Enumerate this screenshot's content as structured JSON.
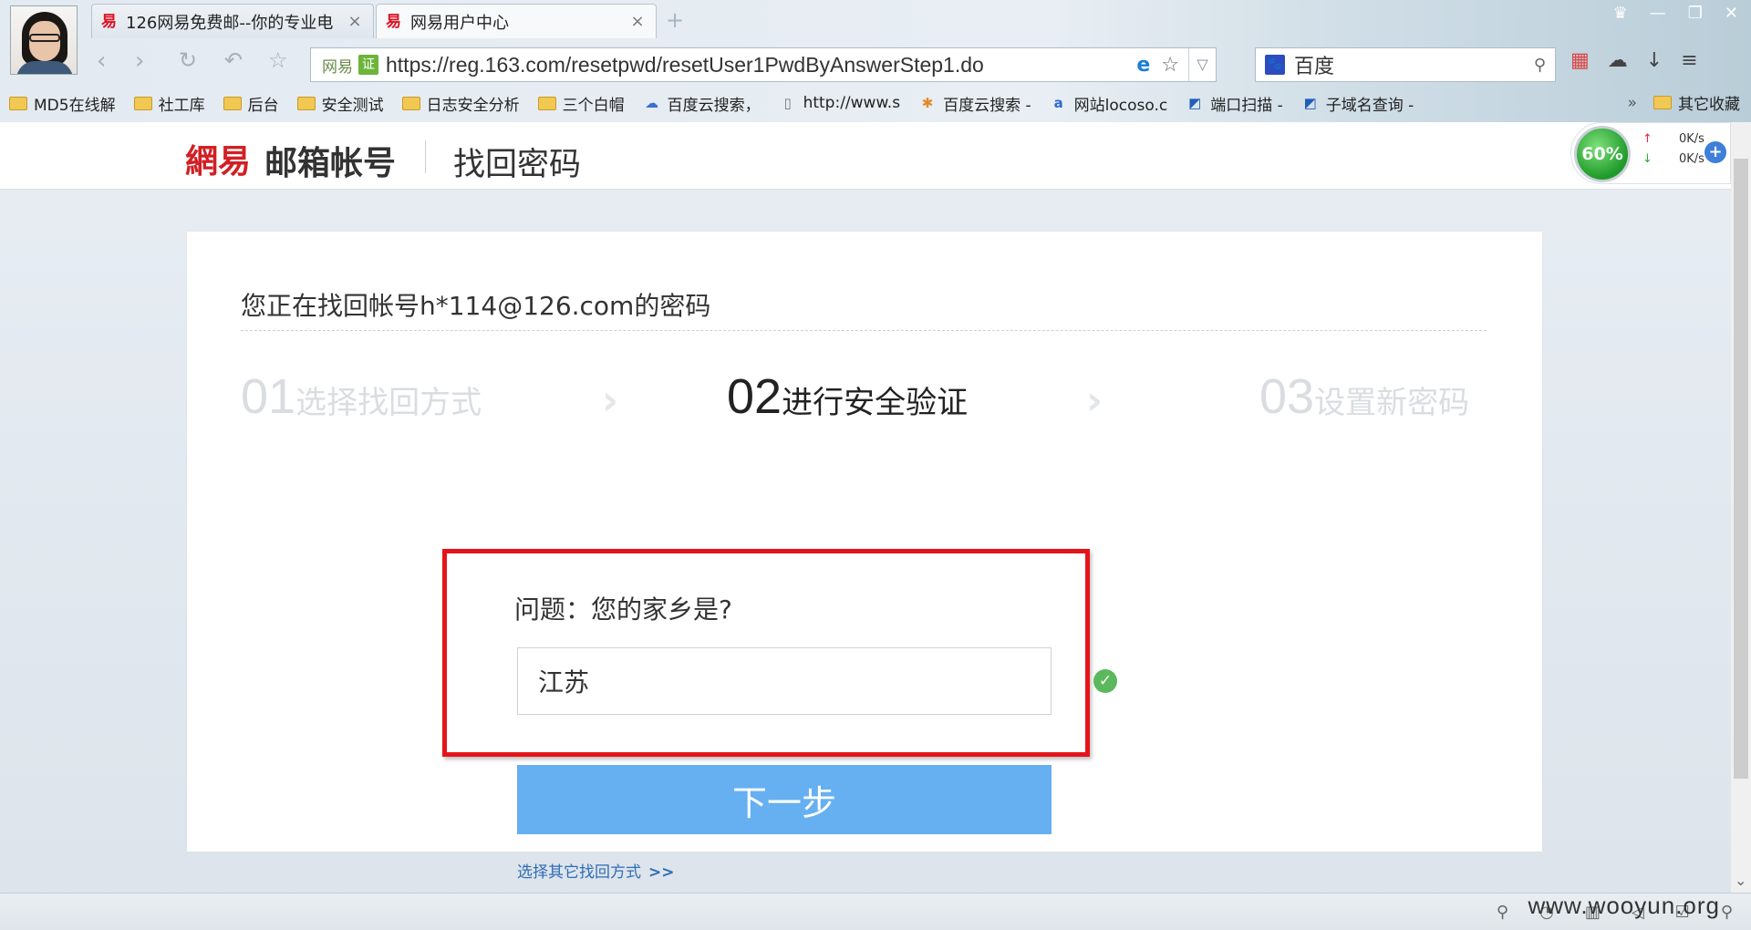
{
  "browser": {
    "tabs": [
      {
        "label": "126网易免费邮--你的专业电",
        "favicon": "易"
      },
      {
        "label": "网易用户中心",
        "favicon": "易"
      }
    ],
    "tab_close": "×",
    "new_tab": "+",
    "address": {
      "site_label": "网易",
      "cert_label": "证",
      "url": "https://reg.163.com/resetpwd/resetUser1PwdByAnswerStep1.do"
    },
    "search": {
      "engine": "百度"
    },
    "bookmarks": [
      {
        "label": "MD5在线解",
        "icon": "folder-icon"
      },
      {
        "label": "社工库",
        "icon": "folder-icon"
      },
      {
        "label": "后台",
        "icon": "folder-icon"
      },
      {
        "label": "安全测试",
        "icon": "folder-icon"
      },
      {
        "label": "日志安全分析",
        "icon": "folder-icon"
      },
      {
        "label": "三个白帽",
        "icon": "folder-icon"
      },
      {
        "label": "百度云搜索，",
        "icon": "cloud-icon"
      },
      {
        "label": "http://www.s",
        "icon": "page-icon"
      },
      {
        "label": "百度云搜索 -",
        "icon": "puzzle-icon"
      },
      {
        "label": "网站locoso.c",
        "icon": "a-icon"
      },
      {
        "label": "端口扫描 -",
        "icon": "site-icon"
      },
      {
        "label": "子域名查询 -",
        "icon": "site-icon"
      }
    ],
    "bookmarks_more": "»",
    "other_bookmarks": "其它收藏",
    "speed": {
      "percent": "60%",
      "up": "0K/s",
      "down": "0K/s"
    }
  },
  "page": {
    "header": {
      "logo": "網易",
      "logo_text": "邮箱帐号",
      "title": "找回密码"
    },
    "account_line": "您正在找回帐号h*114@126.com的密码",
    "steps": [
      {
        "num": "01",
        "label": "选择找回方式",
        "active": false
      },
      {
        "num": "02",
        "label": "进行安全验证",
        "active": true
      },
      {
        "num": "03",
        "label": "设置新密码",
        "active": false
      }
    ],
    "step_arrow": "›",
    "question": "问题：您的家乡是?",
    "answer_value": "江苏",
    "next_button": "下一步",
    "other_method_link": "选择其它找回方式",
    "other_method_arrow": ">>"
  },
  "watermark": "www.wooyun.org",
  "colors": {
    "highlight_border": "#e4151a",
    "next_button": "#66b0f1",
    "link": "#2f6cb6",
    "logo_red": "#d21f24",
    "check_green": "#5cb85c"
  }
}
